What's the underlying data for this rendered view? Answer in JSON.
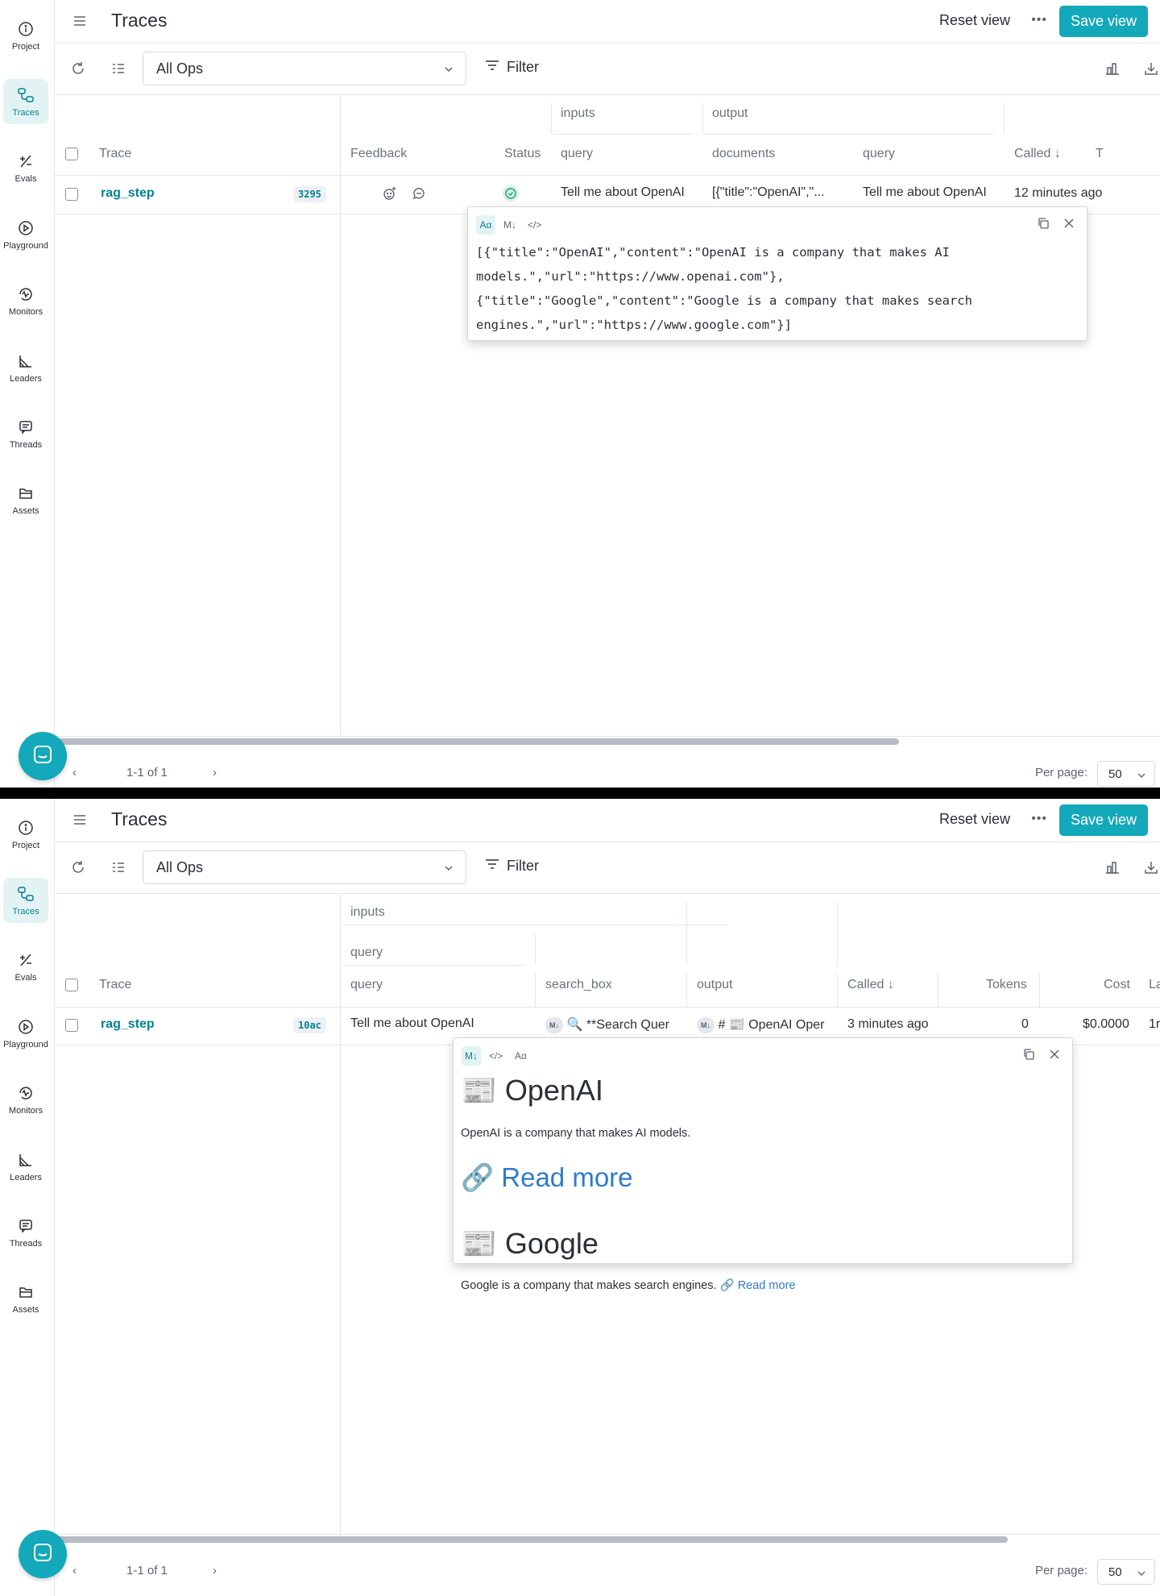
{
  "nav": {
    "items": [
      "Project",
      "Traces",
      "Evals",
      "Playground",
      "Monitors",
      "Leaders",
      "Threads",
      "Assets"
    ],
    "active": "Traces"
  },
  "header": {
    "title": "Traces",
    "reset_label": "Reset view",
    "more_label": "•••",
    "save_label": "Save view"
  },
  "toolbar": {
    "ops_select": "All Ops",
    "filter_label": "Filter"
  },
  "panel1": {
    "group_headers": {
      "inputs": "inputs",
      "output": "output"
    },
    "columns": [
      "Trace",
      "Feedback",
      "Status",
      "query",
      "documents",
      "query",
      "Called",
      "T"
    ],
    "row": {
      "trace": "rag_step",
      "badge": "3295",
      "query": "Tell me about OpenAI",
      "documents": "[{\"title\":\"OpenAI\",\"...",
      "out_query": "Tell me about OpenAI",
      "called": "12 minutes ago"
    },
    "popover": {
      "tools": [
        "Aα",
        "M↓",
        "</>"
      ],
      "lines": [
        "[{\"title\":\"OpenAI\",\"content\":\"OpenAI is a company that makes AI",
        "models.\",\"url\":\"https://www.openai.com\"},",
        "{\"title\":\"Google\",\"content\":\"Google is a company that makes search",
        "engines.\",\"url\":\"https://www.google.com\"}]"
      ]
    },
    "pagination": "1-1 of 1",
    "per_page_label": "Per page:",
    "per_page_value": "50"
  },
  "panel2": {
    "group_headers": {
      "inputs": "inputs",
      "query": "query"
    },
    "columns": [
      "Trace",
      "query",
      "search_box",
      "output",
      "Called",
      "Tokens",
      "Cost",
      "La"
    ],
    "row": {
      "trace": "rag_step",
      "badge": "10ac",
      "query": "Tell me about OpenAI",
      "search_box": "🔍 **Search Quer",
      "output": "# 📰 OpenAI Oper",
      "called": "3 minutes ago",
      "tokens": "0",
      "cost": "$0.0000",
      "la": "1r"
    },
    "popover": {
      "tools": [
        "M↓",
        "</>",
        "Aα"
      ],
      "h1": "📰 OpenAI",
      "p1": "OpenAI is a company that makes AI models.",
      "link1_icon": "🔗",
      "link1": "Read more",
      "h2": "📰 Google",
      "p2": "Google is a company that makes search engines.",
      "link2_icon": "🔗",
      "link2": "Read more"
    },
    "pagination": "1-1 of 1",
    "per_page_label": "Per page:",
    "per_page_value": "50"
  },
  "colors": {
    "accent": "#13a9ba",
    "link": "#038194",
    "active_nav_bg": "#e3f3f4"
  }
}
